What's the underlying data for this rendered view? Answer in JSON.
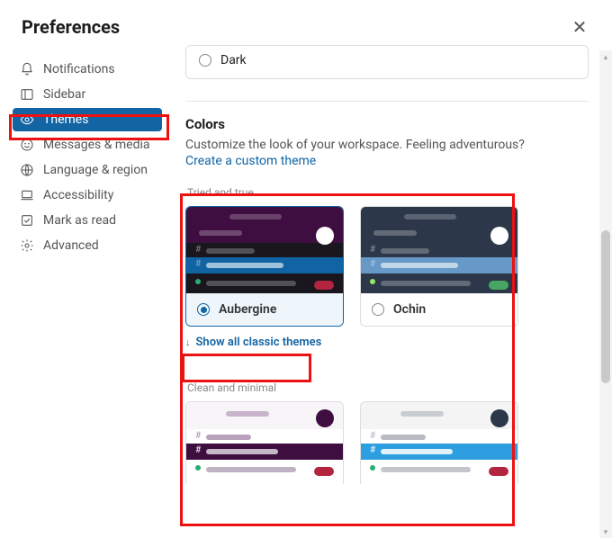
{
  "header": {
    "title": "Preferences"
  },
  "sidebar": {
    "items": [
      {
        "label": "Notifications"
      },
      {
        "label": "Sidebar"
      },
      {
        "label": "Themes"
      },
      {
        "label": "Messages & media"
      },
      {
        "label": "Language & region"
      },
      {
        "label": "Accessibility"
      },
      {
        "label": "Mark as read"
      },
      {
        "label": "Advanced"
      }
    ]
  },
  "content": {
    "dark_option_label": "Dark",
    "colors_heading": "Colors",
    "colors_desc": "Customize the look of your workspace. Feeling adventurous?",
    "create_theme_link": "Create a custom theme",
    "group1_label": "Tried and true",
    "theme1_name": "Aubergine",
    "theme2_name": "Ochin",
    "show_all_link": "Show all classic themes",
    "group2_label": "Clean and minimal"
  }
}
